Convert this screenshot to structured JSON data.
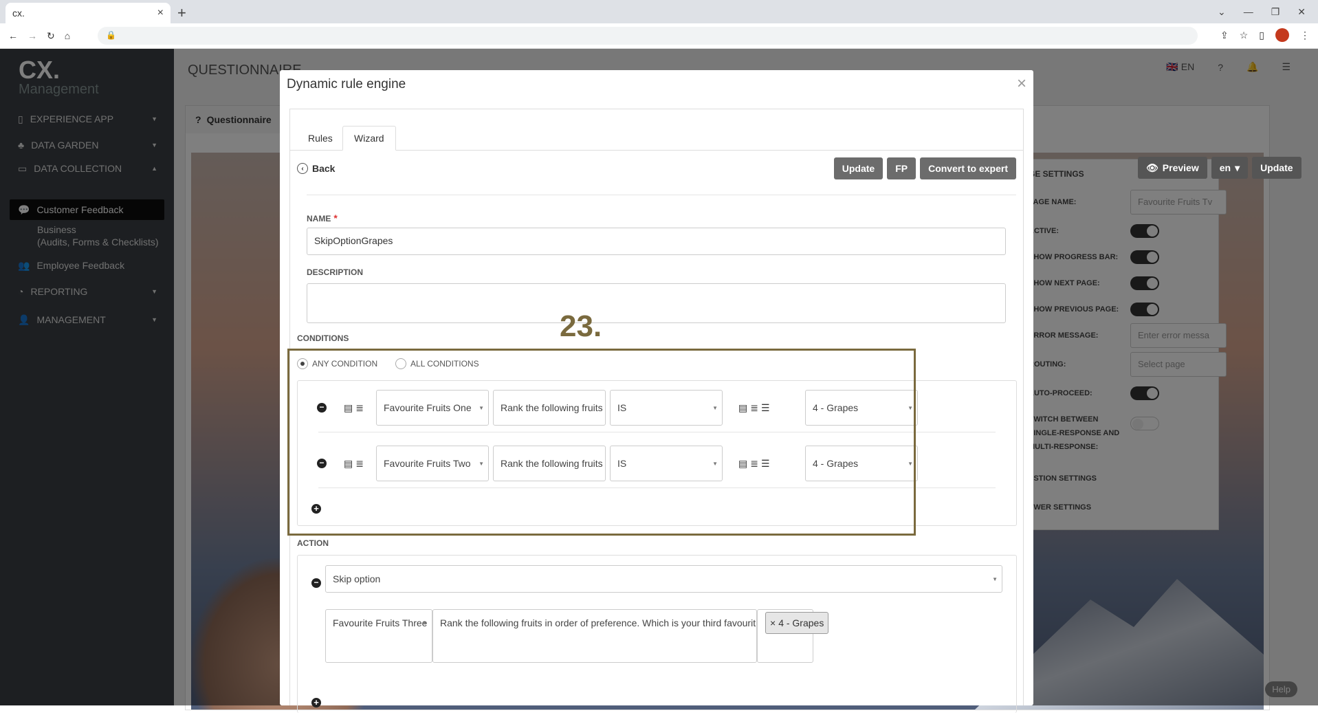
{
  "browser": {
    "tab_title": "cx.",
    "close_glyph": "×",
    "new_tab_glyph": "+"
  },
  "sidebar": {
    "logo": "CX.",
    "logo_sub": "Management",
    "items": [
      {
        "label": "EXPERIENCE APP"
      },
      {
        "label": "DATA GARDEN"
      },
      {
        "label": "DATA COLLECTION"
      },
      {
        "label": "Customer Feedback"
      },
      {
        "label": "Business"
      },
      {
        "label": "(Audits, Forms & Checklists)"
      },
      {
        "label": "Employee Feedback"
      },
      {
        "label": "REPORTING"
      },
      {
        "label": "MANAGEMENT"
      }
    ]
  },
  "header": {
    "title": "QUESTIONNAIRE",
    "lang": "EN"
  },
  "questionnaire": {
    "tab": "Questionnaire",
    "preview": "Preview",
    "lang": "en",
    "update": "Update"
  },
  "page_settings": {
    "title": "GE SETTINGS",
    "page_name_label": "PAGE NAME:",
    "page_name_value": "Favourite Fruits Tv",
    "active": "ACTIVE:",
    "progress": "SHOW PROGRESS BAR:",
    "next": "SHOW NEXT PAGE:",
    "previous": "SHOW PREVIOUS PAGE:",
    "error": "ERROR MESSAGE:",
    "error_placeholder": "Enter error messa",
    "routing": "ROUTING:",
    "routing_value": "Select page",
    "auto": "AUTO-PROCEED:",
    "switch1": "SWITCH BETWEEN",
    "switch2": "SINGLE-RESPONSE AND",
    "switch3": "MULTI-RESPONSE:",
    "q_settings": "ESTION SETTINGS",
    "a_settings": "SWER SETTINGS",
    "help": "Help"
  },
  "modal": {
    "title": "Dynamic rule engine",
    "close": "×",
    "tabs": [
      {
        "label": "Rules"
      },
      {
        "label": "Wizard"
      }
    ],
    "back": "Back",
    "buttons": {
      "update": "Update",
      "fp": "FP",
      "convert": "Convert to expert"
    },
    "name_label": "NAME",
    "name_required": "*",
    "name_value": "SkipOptionGrapes",
    "description_label": "DESCRIPTION",
    "description_value": "",
    "conditions_label": "CONDITIONS",
    "any_condition": "ANY CONDITION",
    "all_conditions": "ALL CONDITIONS",
    "conditions": [
      {
        "page": "Favourite Fruits One",
        "question": "Rank the following fruits",
        "operator": "IS",
        "value": "4 - Grapes"
      },
      {
        "page": "Favourite Fruits Two",
        "question": "Rank the following fruits",
        "operator": "IS",
        "value": "4 - Grapes"
      }
    ],
    "action_label": "ACTION",
    "action_type": "Skip option",
    "action_page": "Favourite Fruits Three",
    "action_question": "Rank the following fruits in order of preference. Which is your third favourit",
    "action_tag": "4 - Grapes",
    "annotation": "23."
  },
  "colors": {
    "annotation": "#7a6a3e",
    "button": "#6c6c6c"
  }
}
